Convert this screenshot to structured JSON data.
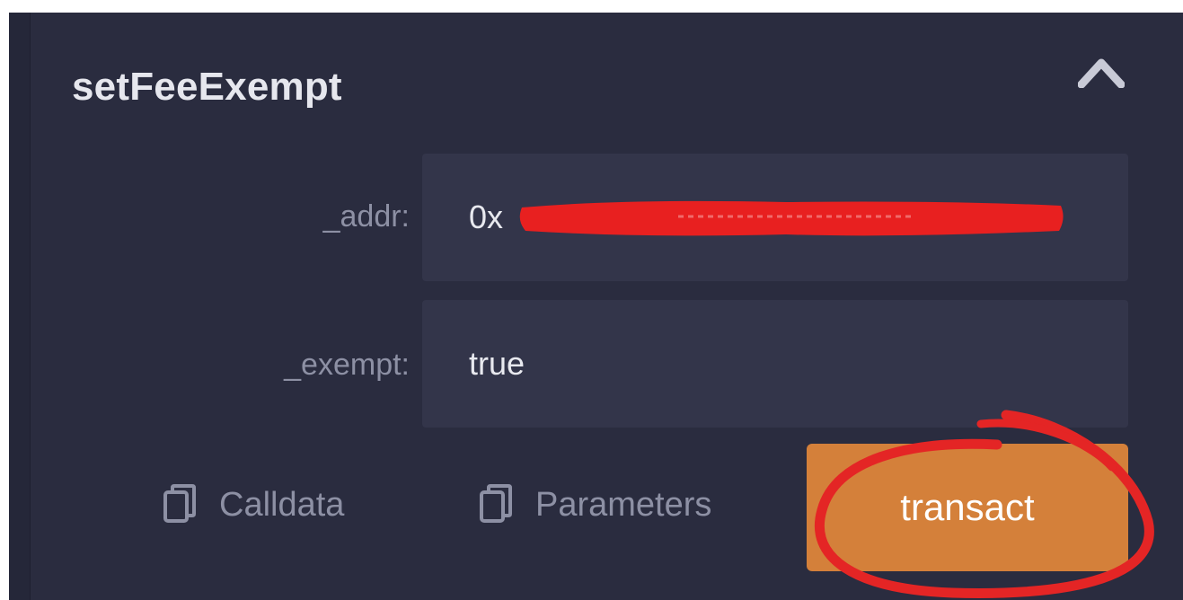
{
  "function": {
    "name": "setFeeExempt",
    "collapse_icon": "chevron-up-icon"
  },
  "inputs": [
    {
      "label": "_addr:",
      "value": "0x"
    },
    {
      "label": "_exempt:",
      "value": "true"
    }
  ],
  "actions": {
    "calldata_label": "Calldata",
    "parameters_label": "Parameters",
    "copy_icon": "copy-icon",
    "transact_label": "transact"
  },
  "colors": {
    "panel": "#2a2c3f",
    "field": "#33354a",
    "transact": "#d4803a",
    "annotation": "#e02020"
  }
}
